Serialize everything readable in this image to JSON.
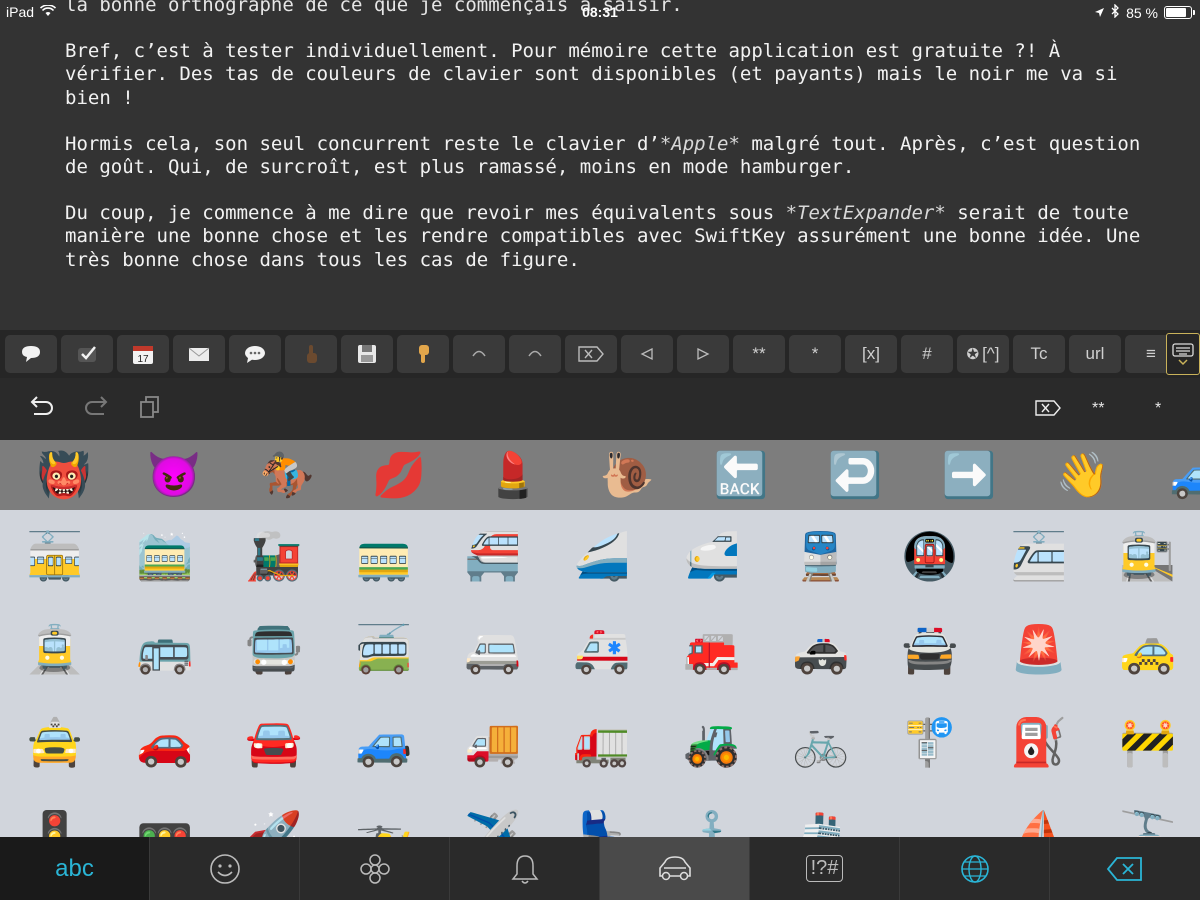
{
  "status_bar": {
    "device": "iPad",
    "time": "08:31",
    "battery": "85 %",
    "battery_level": 0.85
  },
  "editor": {
    "cut_line": "la bonne orthographe de ce que je commençais à saisir.",
    "p1": "Bref, c’est à tester individuellement. Pour mémoire cette application est gratuite ?! À vérifier. Des tas de couleurs de clavier sont disponibles (et payants) mais le noir me va si bien !",
    "p2_a": "Hormis cela, son seul concurrent reste le clavier d’",
    "p2_em": "*Apple*",
    "p2_b": " malgré tout. Après, c’est question de goût. Qui, de surcroît, est plus ramassé, moins en mode hamburger.",
    "p3_a": "Du coup, je commence à me dire que revoir mes équivalents sous ",
    "p3_em": "*TextExpander*",
    "p3_b": " serait de toute manière une bonne chose et les rendre compatibles avec SwiftKey assurément une bonne idée. Une très bonne chose dans tous les cas de figure."
  },
  "toolbar": {
    "calendar_day": "17",
    "bold": "**",
    "italic": "*",
    "link_ref": "[x]",
    "header": "#",
    "footnote": "[^]",
    "title_case": "Tc",
    "url": "url",
    "list": "≡"
  },
  "keyboard_top": {
    "delete_word": "⌦",
    "bold": "**",
    "italic": "*"
  },
  "recents": [
    "👹",
    "😈",
    "🏇",
    "💋",
    "💄",
    "🐌",
    "🔙",
    "↩️",
    "➡️",
    "👋",
    "🚙"
  ],
  "emoji_grid": {
    "row1": [
      "🚋",
      "🚞",
      "🚂",
      "🚃",
      "🚝",
      "🚄",
      "🚅",
      "🚆",
      "🚇",
      "🚈",
      "🚉"
    ],
    "row2": [
      "🚊",
      "🚌",
      "🚍",
      "🚎",
      "🚐",
      "🚑",
      "🚒",
      "🚓",
      "🚔",
      "🚨",
      "🚕"
    ],
    "row3": [
      "🚖",
      "🚗",
      "🚘",
      "🚙",
      "🚚",
      "🚛",
      "🚜",
      "🚲",
      "🚏",
      "⛽",
      "🚧"
    ],
    "row4": [
      "🚦",
      "🚥",
      "🚀",
      "🚁",
      "✈️",
      "💺",
      "⚓",
      "🚢",
      "🚤",
      "⛵",
      "🚡"
    ]
  },
  "bottom_bar": {
    "abc": "abc",
    "symbols": "!?#"
  },
  "colors": {
    "editor_bg": "#333333",
    "keyboard_bg": "#2a2a2a",
    "grid_bg": "#d1d5dc",
    "accent": "#2ab5d6"
  }
}
